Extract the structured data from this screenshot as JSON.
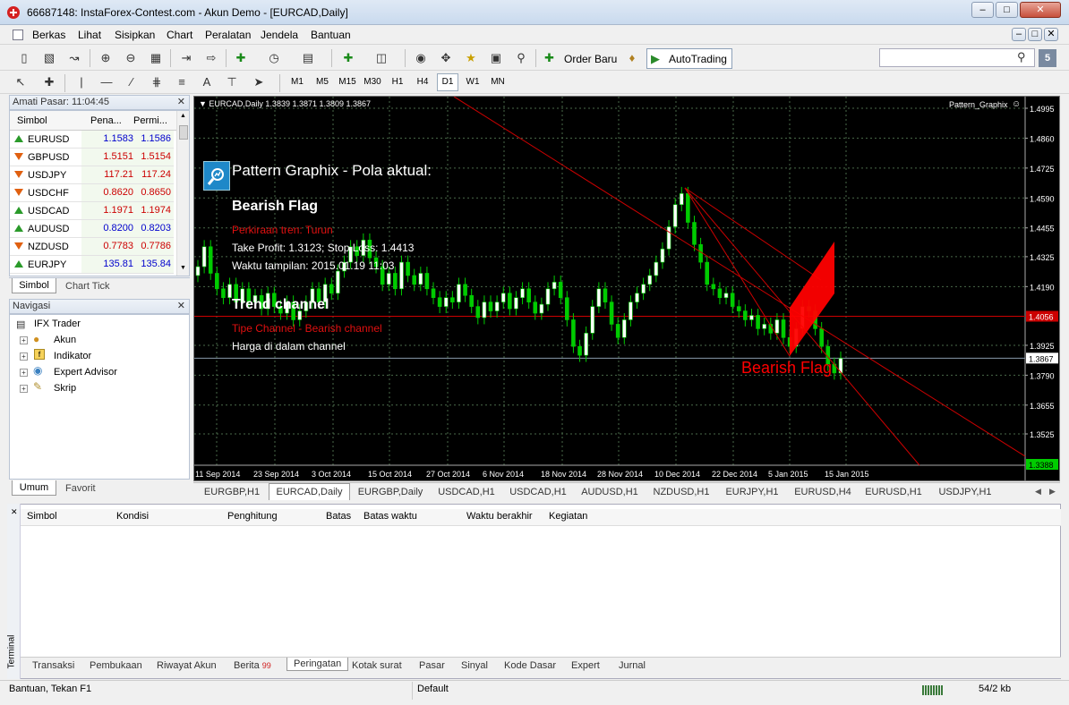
{
  "window": {
    "title": "66687148: InstaForex-Contest.com - Akun Demo - [EURCAD,Daily]"
  },
  "menu": [
    "Berkas",
    "Lihat",
    "Sisipkan",
    "Chart",
    "Peralatan",
    "Jendela",
    "Bantuan"
  ],
  "toolbar": {
    "order_label": "Order Baru",
    "autotrading_label": "AutoTrading",
    "search_placeholder": "",
    "badge": "5"
  },
  "timeframes": [
    "M1",
    "M5",
    "M15",
    "M30",
    "H1",
    "H4",
    "D1",
    "W1",
    "MN"
  ],
  "active_timeframe": "D1",
  "market_watch": {
    "title": "Amati Pasar: 11:04:45",
    "headers": [
      "Simbol",
      "Pena...",
      "Permi..."
    ],
    "rows": [
      {
        "symbol": "EURUSD",
        "bid": "1.1583",
        "ask": "1.1586",
        "dir": "up",
        "color": "#0000cc"
      },
      {
        "symbol": "GBPUSD",
        "bid": "1.5151",
        "ask": "1.5154",
        "dir": "dn",
        "color": "#cc0000"
      },
      {
        "symbol": "USDJPY",
        "bid": "117.21",
        "ask": "117.24",
        "dir": "dn",
        "color": "#cc0000"
      },
      {
        "symbol": "USDCHF",
        "bid": "0.8620",
        "ask": "0.8650",
        "dir": "dn",
        "color": "#cc0000"
      },
      {
        "symbol": "USDCAD",
        "bid": "1.1971",
        "ask": "1.1974",
        "dir": "up",
        "color": "#cc0000"
      },
      {
        "symbol": "AUDUSD",
        "bid": "0.8200",
        "ask": "0.8203",
        "dir": "up",
        "color": "#0000cc"
      },
      {
        "symbol": "NZDUSD",
        "bid": "0.7783",
        "ask": "0.7786",
        "dir": "dn",
        "color": "#cc0000"
      },
      {
        "symbol": "EURJPY",
        "bid": "135.81",
        "ask": "135.84",
        "dir": "up",
        "color": "#0000cc"
      }
    ],
    "tabs": [
      "Simbol",
      "Chart Tick"
    ]
  },
  "navigator": {
    "title": "Navigasi",
    "root": "IFX Trader",
    "items": [
      "Akun",
      "Indikator",
      "Expert Advisor",
      "Skrip"
    ],
    "tabs": [
      "Umum",
      "Favorit"
    ]
  },
  "chart": {
    "header": "EURCAD,Daily  1.3839 1.3871 1.3809 1.3867",
    "indicator_name": "Pattern_Graphix",
    "panel_title": "Pattern Graphix - Pola aktual:",
    "pattern_name": "Bearish Flag",
    "trend_forecast": "Perkiraan tren: Turun",
    "tp_sl": "Take Profit: 1.3123; Stop Loss: 1.4413",
    "display_time": "Waktu tampilan: 2015.01.19 11:03",
    "channel_title": "Trend channel",
    "channel_type": "Tipe Channel - Bearish channel",
    "channel_pos": "Harga di dalam channel",
    "pattern_label": "Bearish Flag",
    "price_labels": [
      "1.4995",
      "1.4860",
      "1.4725",
      "1.4590",
      "1.4455",
      "1.4325",
      "1.4190",
      "1.4056",
      "1.3925",
      "1.3867",
      "1.3790",
      "1.3655",
      "1.3525",
      "1.3388"
    ],
    "date_labels": [
      "11 Sep 2014",
      "23 Sep 2014",
      "3 Oct 2014",
      "15 Oct 2014",
      "27 Oct 2014",
      "6 Nov 2014",
      "18 Nov 2014",
      "28 Nov 2014",
      "10 Dec 2014",
      "22 Dec 2014",
      "5 Jan 2015",
      "15 Jan 2015"
    ],
    "current_price": "1.3867",
    "red_level": "1.4056",
    "bottom_level": "1.3388"
  },
  "chart_tabs": [
    "EURGBP,H1",
    "EURCAD,Daily",
    "EURGBP,Daily",
    "USDCAD,H1",
    "USDCAD,H1",
    "AUDUSD,H1",
    "NZDUSD,H1",
    "EURJPY,H1",
    "EURUSD,H4",
    "EURUSD,H1",
    "USDJPY,H1"
  ],
  "active_chart_tab": 1,
  "terminal": {
    "label": "Terminal",
    "columns": [
      "Simbol",
      "Kondisi",
      "Penghitung",
      "Batas",
      "Batas waktu",
      "Waktu berakhir",
      "Kegiatan"
    ],
    "tabs": [
      "Transaksi",
      "Pembukaan",
      "Riwayat Akun",
      "Berita",
      "Peringatan",
      "Kotak surat",
      "Pasar",
      "Sinyal",
      "Kode Dasar",
      "Expert",
      "Jurnal"
    ],
    "news_count": "99",
    "active_tab": 4
  },
  "status": {
    "help": "Bantuan, Tekan F1",
    "profile": "Default",
    "traffic": "54/2 kb"
  },
  "colors": {
    "bull": "#ffffff",
    "bear": "#00cc00",
    "wick": "#00cc00",
    "channel": "#cc0000",
    "flag": "#ff0000",
    "grid": "#4a6a4a"
  }
}
